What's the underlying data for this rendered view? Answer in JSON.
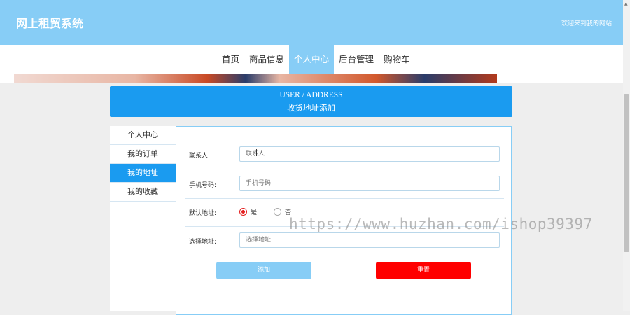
{
  "header": {
    "site_title": "网上租贸系统",
    "welcome_text": "欢迎来到我的网站"
  },
  "nav": {
    "items": [
      {
        "label": "首页"
      },
      {
        "label": "商品信息"
      },
      {
        "label": "个人中心"
      },
      {
        "label": "后台管理"
      },
      {
        "label": "购物车"
      }
    ],
    "active_index": 2
  },
  "page_header": {
    "title_en": "USER / ADDRESS",
    "title_cn": "收货地址添加"
  },
  "sidebar": {
    "items": [
      {
        "label": "个人中心"
      },
      {
        "label": "我的订单"
      },
      {
        "label": "我的地址"
      },
      {
        "label": "我的收藏"
      }
    ],
    "active_index": 2
  },
  "form": {
    "contact": {
      "label": "联系人:",
      "placeholder": "联系人",
      "value": ""
    },
    "phone": {
      "label": "手机号码:",
      "placeholder": "手机号码",
      "value": ""
    },
    "default_address": {
      "label": "默认地址:",
      "options": [
        "是",
        "否"
      ],
      "selected": "是"
    },
    "address": {
      "label": "选择地址:",
      "placeholder": "选择地址",
      "value": ""
    },
    "add_button": "添加",
    "reset_button": "重置"
  },
  "watermark": "https://www.huzhan.com/ishop39397",
  "colors": {
    "topbar": "#87cdf6",
    "primary": "#1a9bf0",
    "reset": "#ff0000"
  }
}
